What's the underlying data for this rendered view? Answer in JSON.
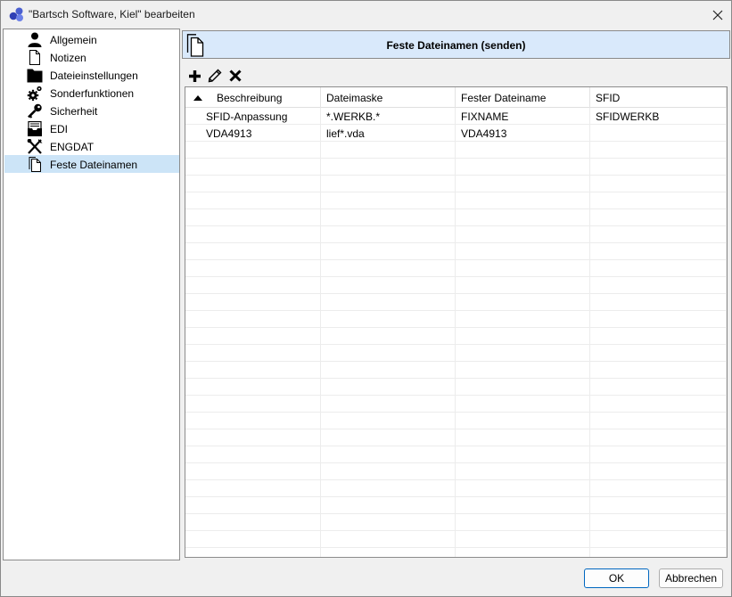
{
  "window": {
    "title": "\"Bartsch Software, Kiel\" bearbeiten",
    "close_glyph": "✕"
  },
  "sidebar": {
    "items": [
      {
        "label": "Allgemein",
        "icon": "user-icon"
      },
      {
        "label": "Notizen",
        "icon": "document-icon"
      },
      {
        "label": "Dateieinstellungen",
        "icon": "folder-icon"
      },
      {
        "label": "Sonderfunktionen",
        "icon": "gears-icon"
      },
      {
        "label": "Sicherheit",
        "icon": "key-icon"
      },
      {
        "label": "EDI",
        "icon": "inbox-icon"
      },
      {
        "label": "ENGDAT",
        "icon": "tools-icon"
      },
      {
        "label": "Feste Dateinamen",
        "icon": "documents-icon",
        "selected": true
      }
    ]
  },
  "main": {
    "header_title": "Feste Dateinamen (senden)",
    "toolbar": {
      "add": "add-icon",
      "edit": "pencil-icon",
      "delete": "delete-icon"
    },
    "table": {
      "columns": [
        "Beschreibung",
        "Dateimaske",
        "Fester Dateiname",
        "SFID"
      ],
      "sort_column": "Beschreibung",
      "sort_direction": "ascending",
      "rows": [
        [
          "SFID-Anpassung",
          "*.WERKB.*",
          "FIXNAME",
          "SFIDWERKB"
        ],
        [
          "VDA4913",
          "lief*.vda",
          "VDA4913",
          ""
        ]
      ]
    }
  },
  "footer": {
    "ok_label": "OK",
    "cancel_label": "Abbrechen"
  },
  "colors": {
    "header_bg": "#d9e9fb",
    "selected_bg": "#cce4f7",
    "accent": "#0067c0"
  }
}
